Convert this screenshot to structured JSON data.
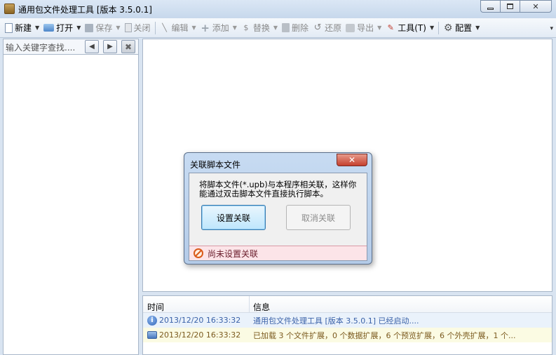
{
  "window": {
    "title": "通用包文件处理工具 [版本 3.5.0.1]",
    "controls": {
      "minimize": "minimize",
      "maximize": "maximize",
      "close": "✕"
    }
  },
  "toolbar": {
    "new": "新建",
    "open": "打开",
    "save": "保存",
    "close": "关闭",
    "edit": "编辑",
    "add": "添加",
    "replace": "替换",
    "delete": "删除",
    "restore": "还原",
    "export": "导出",
    "tools": "工具(T)",
    "config": "配置"
  },
  "left_panel": {
    "search_text": "输入关键字查找...."
  },
  "log": {
    "columns": {
      "time": "时间",
      "message": "信息"
    },
    "rows": [
      {
        "time": "2013/12/20 16:33:32",
        "message": "通用包文件处理工具 [版本 3.5.0.1] 已经启动....",
        "icon": "info-icon"
      },
      {
        "time": "2013/12/20 16:33:32",
        "message": "已加载 3 个文件扩展，0 个数据扩展，6 个预览扩展，6 个外壳扩展，1 个...",
        "icon": "message-icon"
      }
    ]
  },
  "dialog": {
    "title": "关联脚本文件",
    "close_label": "✕",
    "text": "将脚本文件(*.upb)与本程序相关联，这样你能通过双击脚本文件直接执行脚本。",
    "set_button": "设置关联",
    "cancel_button": "取消关联",
    "status": "尚未设置关联"
  }
}
